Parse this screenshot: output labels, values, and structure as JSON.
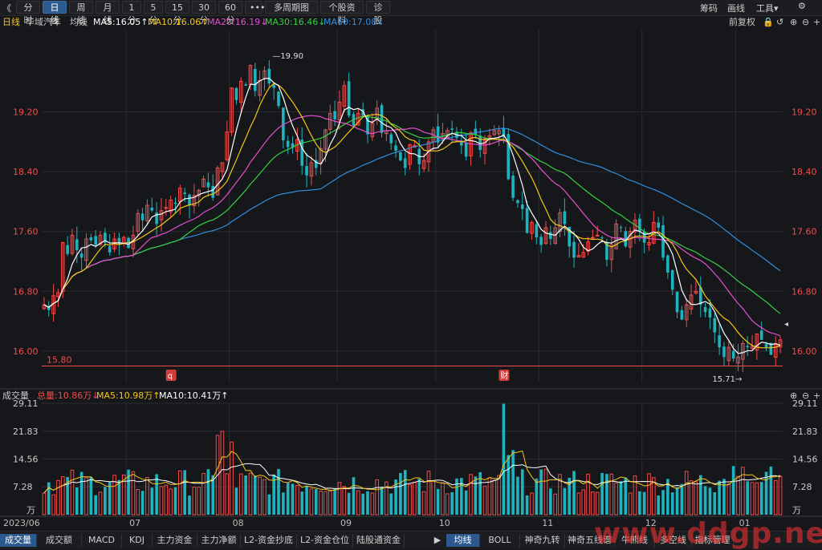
{
  "toolbar": {
    "back": "《",
    "periods": [
      "分时",
      "日线",
      "周线",
      "月线",
      "1分",
      "5分",
      "15分",
      "30分",
      "60分",
      "•••"
    ],
    "active_period": "日线",
    "multi": "多周期图",
    "info": "个股资料",
    "diag": "诊股",
    "right": [
      "筹码",
      "画线",
      "工具▾"
    ],
    "settings_icon": "⚙",
    "window_icons": [
      "—",
      "☐",
      "✕"
    ]
  },
  "mabar": {
    "period": "日线",
    "stock": "华域汽车",
    "kind": "均线",
    "ma5": "MA5:16.05↑",
    "ma10": "MA10:16.06↑",
    "ma20": "MA20:16.19↓",
    "ma30": "MA30:16.46↓",
    "ma60": "MA60:17.08↓",
    "fq": "前复权",
    "icons": [
      "🔒",
      "↺",
      "⊕",
      "⊖",
      "+"
    ]
  },
  "volbar": {
    "label": "成交量",
    "total": "总量:10.86万↓",
    "ma5": "MA5:10.98万↑",
    "ma10": "MA10:10.41万↑",
    "icons": [
      "⊕",
      "⊖",
      "+"
    ]
  },
  "bottom_tabs_left": [
    "成交量",
    "成交额",
    "MACD",
    "KDJ",
    "主力资金",
    "主力净额",
    "L2-资金抄底",
    "L2-资金仓位",
    "陆股通资金"
  ],
  "bottom_tabs_right": [
    "均线",
    "BOLL",
    "神奇九转",
    "神奇五线谱",
    "牛熊线",
    "多空线",
    "指标管理"
  ],
  "bottom_arrow": "▶",
  "watermark": "www.ddgp.net",
  "colors": {
    "up": "#f24b4b",
    "down": "#1fb3bf",
    "ma5": "#ffffff",
    "ma10": "#f5c518",
    "ma20": "#e64fd2",
    "ma30": "#36d142",
    "ma60": "#2f8fe0",
    "bg": "#16171a",
    "grid": "#2a2b30"
  },
  "chart_data": [
    {
      "type": "candlestick",
      "title": "华域汽车 日线",
      "y_ticks": [
        "19.20",
        "18.40",
        "17.60",
        "16.80",
        "16.00"
      ],
      "y_tick_values": [
        19.2,
        18.4,
        17.6,
        16.8,
        16.0
      ],
      "ylim": [
        15.58,
        20.3
      ],
      "x_labels": [
        "2023/06",
        "07",
        "08",
        "09",
        "10",
        "11",
        "12",
        "01"
      ],
      "x_label_index": [
        0,
        18,
        40,
        63,
        84,
        106,
        128,
        148
      ],
      "support_line": 15.8,
      "support_label": "15.80",
      "high_label": "19.90",
      "low_label": "15.71",
      "markers": [
        "q",
        "财"
      ],
      "marker_index": [
        27,
        98
      ],
      "series_names": [
        "MA5",
        "MA10",
        "MA20",
        "MA30",
        "MA60"
      ],
      "closes": [
        16.62,
        16.55,
        16.74,
        16.78,
        17.45,
        17.3,
        17.55,
        17.35,
        17.25,
        17.5,
        17.48,
        17.42,
        17.55,
        17.45,
        17.32,
        17.5,
        17.42,
        17.52,
        17.38,
        17.55,
        17.84,
        17.75,
        17.95,
        17.88,
        17.7,
        17.88,
        17.92,
        18.02,
        17.97,
        18.18,
        18.1,
        17.95,
        18.08,
        18.15,
        18.3,
        18.19,
        18.05,
        18.45,
        18.52,
        18.93,
        19.52,
        19.36,
        19.61,
        19.55,
        19.82,
        19.48,
        19.62,
        19.75,
        19.58,
        19.52,
        19.28,
        18.82,
        18.73,
        18.72,
        18.83,
        18.48,
        18.35,
        18.52,
        18.45,
        18.71,
        18.96,
        19.18,
        19.1,
        19.33,
        19.55,
        19.15,
        19.02,
        19.18,
        19.15,
        18.9,
        19.05,
        19.25,
        18.92,
        18.95,
        18.78,
        18.68,
        18.55,
        18.45,
        18.76,
        18.75,
        18.5,
        18.55,
        18.8,
        18.96,
        18.79,
        18.91,
        18.95,
        18.96,
        18.85,
        18.75,
        18.6,
        18.92,
        18.9,
        18.69,
        18.82,
        18.88,
        18.95,
        18.95,
        18.86,
        18.3,
        18.05,
        17.98,
        17.9,
        17.58,
        17.72,
        17.52,
        17.42,
        17.65,
        17.5,
        17.65,
        17.85,
        17.7,
        17.4,
        17.25,
        17.28,
        17.32,
        17.46,
        17.52,
        17.55,
        17.51,
        17.22,
        17.42,
        17.7,
        17.65,
        17.4,
        17.6,
        17.75,
        17.6,
        17.45,
        17.45,
        17.72,
        17.65,
        17.25,
        17.05,
        16.82,
        16.52,
        16.42,
        16.62,
        16.75,
        16.8,
        16.62,
        16.52,
        16.45,
        16.25,
        16.05,
        15.92,
        16.05,
        15.9,
        15.92,
        16.1,
        16.05,
        16.06,
        16.23,
        16.15,
        16.05,
        15.95,
        16.1,
        16.15
      ],
      "volume_ticks": [
        "29.11",
        "21.83",
        "14.56",
        "7.28",
        "万"
      ],
      "volume_tick_values": [
        29.11,
        21.83,
        14.56,
        7.28
      ],
      "volume_unit": "万",
      "volume_max": 29.11
    }
  ]
}
